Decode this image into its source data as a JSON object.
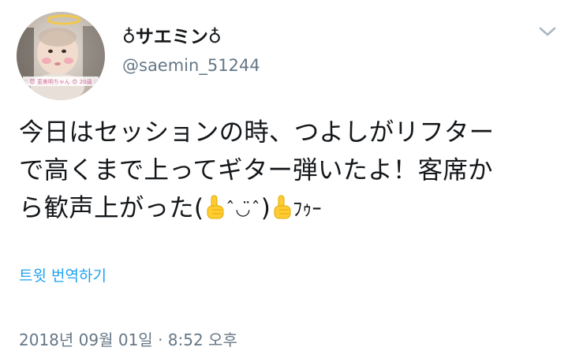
{
  "user": {
    "display_name": "♁サエミン♁",
    "handle": "@saemin_51244",
    "avatar_banner_text": "♡ 😈 恵美明ちゃん 😍 20歳 ♡"
  },
  "tweet": {
    "line1": "今日はセッションの時、つよしがリフター",
    "line2": "で高くまで上ってギター弾いたよ！客席か",
    "line3_prefix": "ら歓声上がった(",
    "line3_face": "ˆ◡̈ˆ",
    "line3_close": ")",
    "line3_suffix": "ﾌｩｰ",
    "emoji": "point-up-hand",
    "translate_label": "트윗 번역하기",
    "timestamp": "2018년 09월 01일 · 8:52 오후"
  },
  "colors": {
    "text": "#14171a",
    "secondary": "#657786",
    "link": "#1da1f2",
    "caret": "#aab8c2"
  },
  "icons": {
    "caret": "chevron-down-icon",
    "emoji": "point-up-icon"
  }
}
